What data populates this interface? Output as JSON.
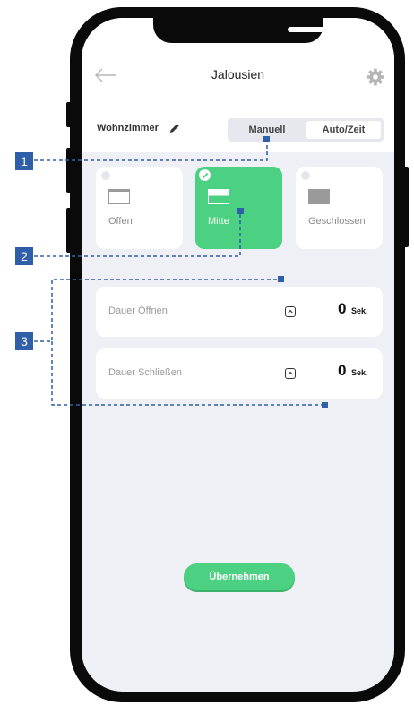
{
  "header": {
    "title": "Jalousien"
  },
  "room": {
    "name": "Wohnzimmer"
  },
  "mode_tabs": [
    {
      "label": "Manuell",
      "selected": true
    },
    {
      "label": "Auto/Zeit",
      "selected": false
    }
  ],
  "positions": [
    {
      "label": "Offen",
      "selected": false
    },
    {
      "label": "Mitte",
      "selected": true
    },
    {
      "label": "Geschlossen",
      "selected": false
    }
  ],
  "durations": [
    {
      "label": "Dauer Öffnen",
      "value": "0",
      "unit": "Sek."
    },
    {
      "label": "Dauer Schließen",
      "value": "0",
      "unit": "Sek."
    }
  ],
  "apply_label": "Übernehmen",
  "callouts": [
    "1",
    "2",
    "3"
  ],
  "colors": {
    "accent": "#4cd081",
    "callout": "#2f5fa8",
    "screen_bg": "#eef0f5",
    "frame": "#0a0a0a"
  },
  "icons": [
    "back-arrow-icon",
    "gear-icon",
    "pencil-icon",
    "check-icon",
    "blind-open-icon",
    "blind-half-icon",
    "blind-closed-icon",
    "stepper-icon"
  ]
}
